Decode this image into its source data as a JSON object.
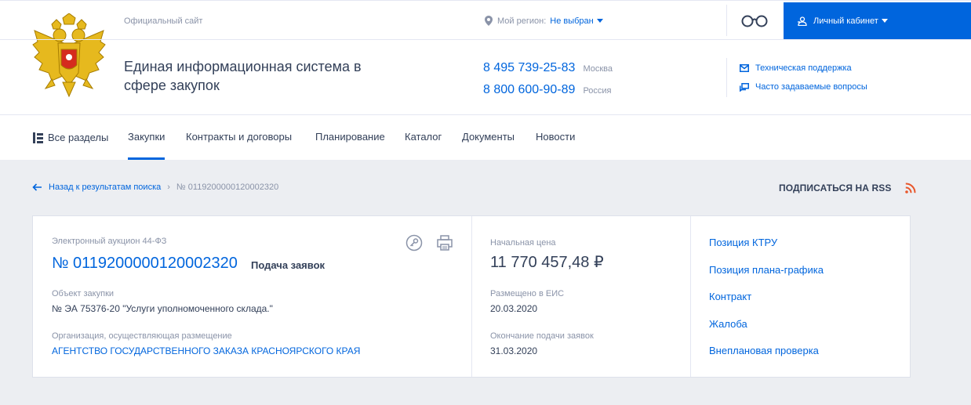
{
  "header": {
    "official_label": "Официальный сайт",
    "title": "Единая информационная система в сфере закупок",
    "region_label": "Мой регион:",
    "region_value": "Не выбран",
    "phones": [
      {
        "number": "8 495 739-25-83",
        "city": "Москва"
      },
      {
        "number": "8 800 600-90-89",
        "city": "Россия"
      }
    ],
    "cabinet_label": "Личный кабинет",
    "support_link": "Техническая поддержка",
    "faq_link": "Часто задаваемые вопросы"
  },
  "nav": {
    "items": [
      {
        "label": "Все разделы"
      },
      {
        "label": "Закупки",
        "active": true
      },
      {
        "label": "Контракты и договоры"
      },
      {
        "label": "Планирование"
      },
      {
        "label": "Каталог"
      },
      {
        "label": "Документы"
      },
      {
        "label": "Новости"
      }
    ]
  },
  "breadcrumb": {
    "back_label": "Назад к результатам поиска",
    "current": "№ 0119200000120002320"
  },
  "rss_label": "ПОДПИСАТЬСЯ НА RSS",
  "purchase": {
    "type": "Электронный аукцион 44-ФЗ",
    "reg_number": "№ 0119200000120002320",
    "status": "Подача заявок",
    "object_label": "Объект закупки",
    "object_value": "№ ЭА 75376-20 \"Услуги уполномоченного склада.\"",
    "org_label": "Организация, осуществляющая размещение",
    "org_value": "АГЕНТСТВО ГОСУДАРСТВЕННОГО ЗАКАЗА КРАСНОЯРСКОГО КРАЯ",
    "price_label": "Начальная цена",
    "price_value": "11 770 457,48 ₽",
    "posted_label": "Размещено в ЕИС",
    "posted_value": "20.03.2020",
    "deadline_label": "Окончание подачи заявок",
    "deadline_value": "31.03.2020"
  },
  "side_links": [
    {
      "label": "Позиция КТРУ"
    },
    {
      "label": "Позиция плана-графика"
    },
    {
      "label": "Контракт"
    },
    {
      "label": "Жалоба"
    },
    {
      "label": "Внеплановая проверка"
    }
  ],
  "colors": {
    "accent": "#0065dd",
    "text": "#334059",
    "muted": "#8a93a8",
    "background": "#eceef2",
    "rss": "#e8572c",
    "crest_gold": "#e6b91e",
    "crest_red": "#d52b1e"
  }
}
